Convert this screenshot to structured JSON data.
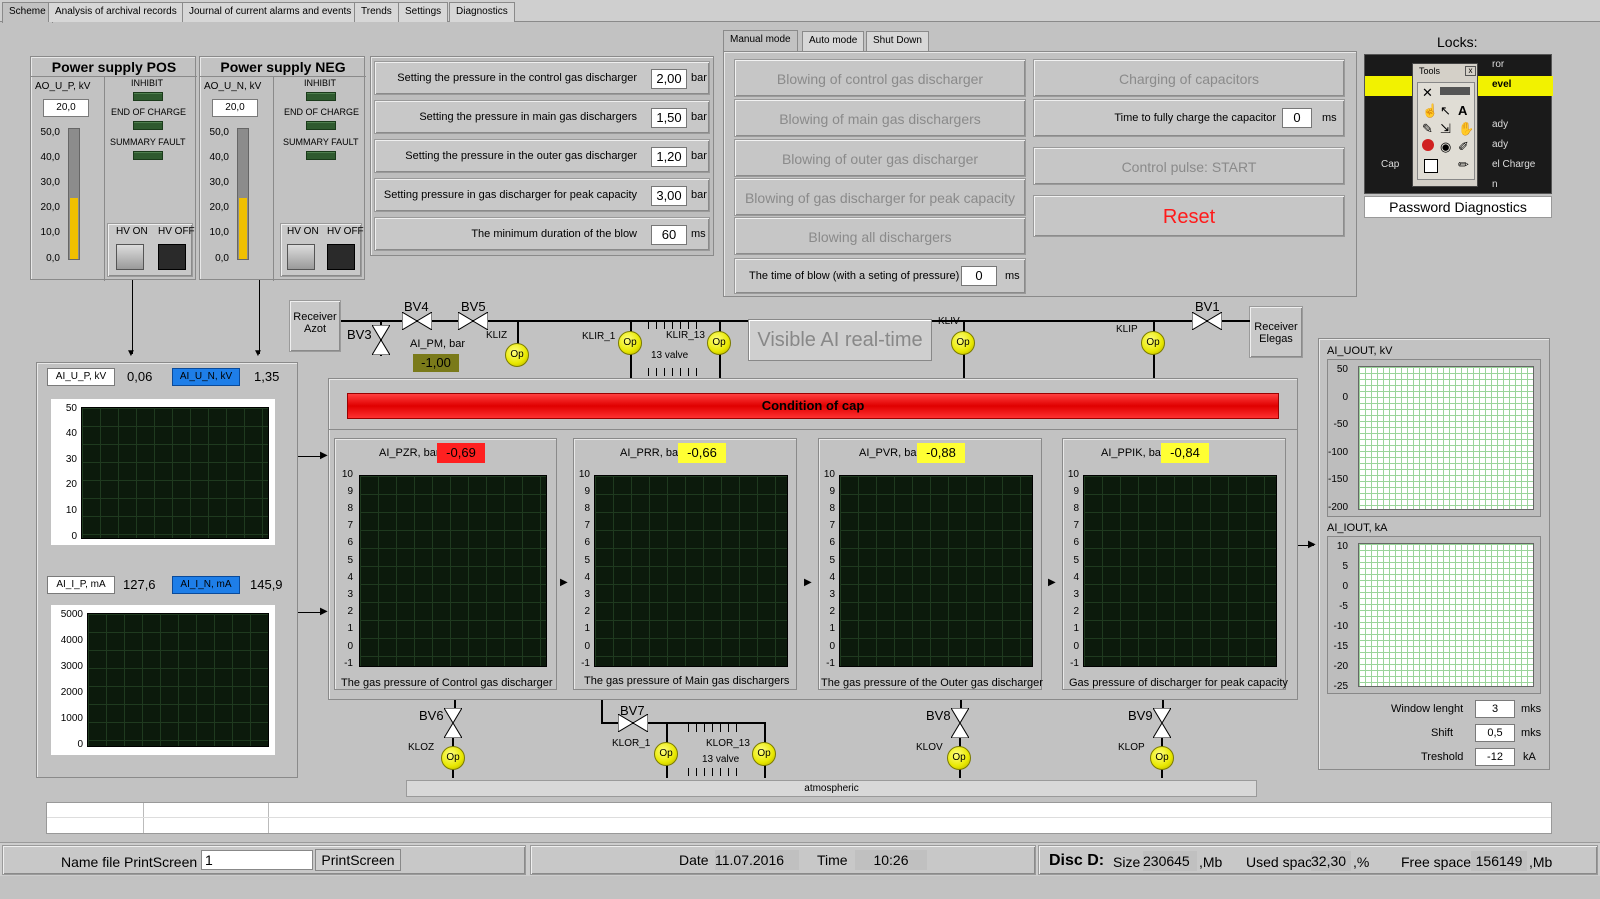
{
  "tabs": [
    "Scheme",
    "Analysis of archival records",
    "Journal of current alarms and events",
    "Trends",
    "Settings",
    "Diagnostics"
  ],
  "pos": {
    "title": "Power supply POS",
    "ao_label": "AO_U_P, kV",
    "ao_value": "20,0",
    "inhibit": "INHIBIT",
    "end_of_charge": "END OF CHARGE",
    "summary_fault": "SUMMARY FAULT",
    "hv_on": "HV ON",
    "hv_off": "HV OFF",
    "level": 0.47
  },
  "neg": {
    "title": "Power supply NEG",
    "ao_label": "AO_U_N, kV",
    "ao_value": "20,0",
    "inhibit": "INHIBIT",
    "end_of_charge": "END OF CHARGE",
    "summary_fault": "SUMMARY FAULT",
    "hv_on": "HV ON",
    "hv_off": "HV OFF",
    "level": 0.47
  },
  "gauge_ticks": [
    "50,0",
    "40,0",
    "30,0",
    "20,0",
    "10,0",
    "0,0"
  ],
  "settings": [
    {
      "label": "Setting the pressure in the control gas discharger",
      "value": "2,00",
      "unit": "bar"
    },
    {
      "label": "Setting the pressure in main gas dischargers",
      "value": "1,50",
      "unit": "bar"
    },
    {
      "label": "Setting the pressure in the outer gas discharger",
      "value": "1,20",
      "unit": "bar"
    },
    {
      "label": "Setting pressure in gas discharger for peak capacity",
      "value": "3,00",
      "unit": "bar"
    },
    {
      "label": "The minimum duration of the blow",
      "value": "60",
      "unit": "ms"
    }
  ],
  "mode_tabs": [
    "Manual mode",
    "Auto mode",
    "Shut Down"
  ],
  "blow_buttons": [
    "Blowing of control gas discharger",
    "Blowing of main gas dischargers",
    "Blowing of outer gas discharger",
    "Blowing of gas discharger for peak capacity",
    "Blowing all dischargers"
  ],
  "blow_time": {
    "label": "The time of blow (with a seting of pressure)",
    "value": "0",
    "unit": "ms"
  },
  "charging": "Charging of capacitors",
  "charge_time": {
    "label": "Time to fully charge the capacitor",
    "value": "0",
    "unit": "ms"
  },
  "control_pulse": "Control pulse: START",
  "reset": "Reset",
  "locks": {
    "title": "Locks:",
    "tools": "Tools",
    "password": "Password Diagnostics",
    "partial": [
      "ror",
      "evel",
      "ady",
      "ady",
      "Cap",
      "el Charge",
      "n"
    ]
  },
  "scheme": {
    "receiver_azot": "Receiver\nAzot",
    "receiver_elegas": "Receiver\nElegas",
    "bv4": "BV4",
    "bv5": "BV5",
    "bv3": "BV3",
    "bv1": "BV1",
    "bv6": "BV6",
    "bv7": "BV7",
    "bv8": "BV8",
    "bv9": "BV9",
    "ai_pm_label": "AI_PM, bar",
    "ai_pm_value": "-1,00",
    "kliz": "KLIZ",
    "klir1": "KLIR_1",
    "klir13": "KLIR_13",
    "valve13": "13 valve",
    "kliv": "KLIV",
    "klip": "KLIP",
    "visible": "Visible AI real-time",
    "kloz": "KLOZ",
    "klor1": "KLOR_1",
    "klor13": "KLOR_13",
    "valve13b": "13 valve",
    "klov": "KLOV",
    "klop": "KLOP",
    "atmospheric": "atmospheric",
    "op": "Op"
  },
  "condition": "Condition of cap",
  "left_charts": {
    "u_label_p": "AI_U_P, kV",
    "u_value_p": "0,06",
    "u_label_n": "AI_U_N, kV",
    "u_value_n": "1,35",
    "u_ticks": [
      "50",
      "40",
      "30",
      "20",
      "10",
      "0"
    ],
    "i_label_p": "AI_I_P, mA",
    "i_value_p": "127,6",
    "i_label_n": "AI_I_N, mA",
    "i_value_n": "145,9",
    "i_ticks": [
      "5000",
      "4000",
      "3000",
      "2000",
      "1000",
      "0"
    ]
  },
  "pressure_charts": [
    {
      "label": "AI_PZR, bar",
      "value": "-0,69",
      "color": "#ff2020",
      "caption": "The gas pressure of Control gas discharger"
    },
    {
      "label": "AI_PRR, bar",
      "value": "-0,66",
      "color": "#ffff33",
      "caption": "The gas pressure of Main gas dischargers"
    },
    {
      "label": "AI_PVR, bar",
      "value": "-0,88",
      "color": "#ffff33",
      "caption": "The gas pressure of the Outer gas discharger"
    },
    {
      "label": "AI_PPIK, bar",
      "value": "-0,84",
      "color": "#ffff33",
      "caption": "Gas pressure of discharger for peak capacity"
    }
  ],
  "pressure_ticks": [
    "10",
    "9",
    "8",
    "7",
    "6",
    "5",
    "4",
    "3",
    "2",
    "1",
    "0",
    "-1"
  ],
  "right_charts": {
    "uout_label": "AI_UOUT, kV",
    "uout_ticks": [
      "50",
      "0",
      "-50",
      "-100",
      "-150",
      "-200"
    ],
    "iout_label": "AI_IOUT, kA",
    "iout_ticks": [
      "10",
      "5",
      "0",
      "-5",
      "-10",
      "-15",
      "-20",
      "-25"
    ],
    "window_label": "Window lenght",
    "window_value": "3",
    "window_unit": "mks",
    "shift_label": "Shift",
    "shift_value": "0,5",
    "shift_unit": "mks",
    "treshold_label": "Treshold",
    "treshold_value": "-12",
    "treshold_unit": "kA"
  },
  "status": {
    "name_file_label": "Name file PrintScreen",
    "name_file_value": "1",
    "printscreen": "PrintScreen",
    "date_label": "Date",
    "date_value": "11.07.2016",
    "time_label": "Time",
    "time_value": "10:26",
    "disc_label": "Disc D:",
    "size_label": "Size",
    "size_value": "230645",
    "size_unit": ",Mb",
    "used_label": "Used space",
    "used_value": "32,30",
    "used_unit": ",%",
    "free_label": "Free space",
    "free_value": "156149",
    "free_unit": ",Mb"
  }
}
